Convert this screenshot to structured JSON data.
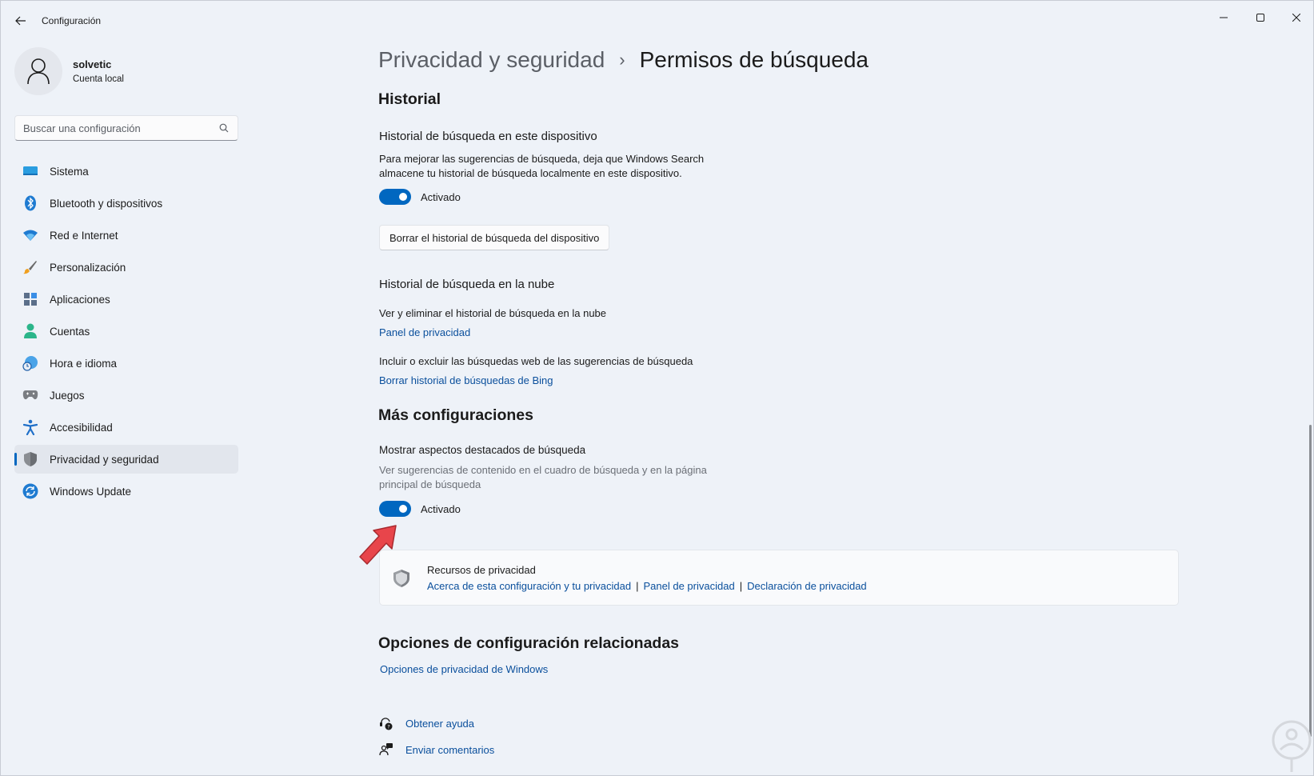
{
  "window": {
    "title": "Configuración"
  },
  "profile": {
    "name": "solvetic",
    "account_type": "Cuenta local"
  },
  "search": {
    "placeholder": "Buscar una configuración"
  },
  "sidebar": {
    "items": [
      {
        "label": "Sistema",
        "icon": "system-icon"
      },
      {
        "label": "Bluetooth y dispositivos",
        "icon": "bluetooth-icon"
      },
      {
        "label": "Red e Internet",
        "icon": "wifi-icon"
      },
      {
        "label": "Personalización",
        "icon": "brush-icon"
      },
      {
        "label": "Aplicaciones",
        "icon": "apps-icon"
      },
      {
        "label": "Cuentas",
        "icon": "account-icon"
      },
      {
        "label": "Hora e idioma",
        "icon": "clock-globe-icon"
      },
      {
        "label": "Juegos",
        "icon": "gamepad-icon"
      },
      {
        "label": "Accesibilidad",
        "icon": "accessibility-icon"
      },
      {
        "label": "Privacidad y seguridad",
        "icon": "shield-icon",
        "active": true
      },
      {
        "label": "Windows Update",
        "icon": "update-icon"
      }
    ]
  },
  "breadcrumb": {
    "parent": "Privacidad y seguridad",
    "separator": "›",
    "current": "Permisos de búsqueda"
  },
  "historial": {
    "heading": "Historial",
    "device": {
      "title": "Historial de búsqueda en este dispositivo",
      "description": "Para mejorar las sugerencias de búsqueda, deja que Windows Search almacene tu historial de búsqueda localmente en este dispositivo.",
      "toggle_label": "Activado",
      "toggle_on": true,
      "clear_button": "Borrar el historial de búsqueda del dispositivo"
    },
    "cloud": {
      "title": "Historial de búsqueda en la nube",
      "desc1": "Ver y eliminar el historial de búsqueda en la nube",
      "link1": "Panel de privacidad",
      "desc2": "Incluir o excluir las búsquedas web de las sugerencias de búsqueda",
      "link2": "Borrar historial de búsquedas de Bing"
    }
  },
  "more": {
    "heading": "Más configuraciones",
    "highlights": {
      "title": "Mostrar aspectos destacados de búsqueda",
      "description": "Ver sugerencias de contenido en el cuadro de búsqueda y en la página principal de búsqueda",
      "toggle_label": "Activado",
      "toggle_on": true
    }
  },
  "resources": {
    "title": "Recursos de privacidad",
    "links": [
      "Acerca de esta configuración y tu privacidad",
      "Panel de privacidad",
      "Declaración de privacidad"
    ],
    "separator": "|"
  },
  "related": {
    "heading": "Opciones de configuración relacionadas",
    "link": "Opciones de privacidad de Windows"
  },
  "help": {
    "get_help": "Obtener ayuda",
    "feedback": "Enviar comentarios"
  },
  "colors": {
    "accent": "#0067c0",
    "link": "#0a4f9c",
    "background": "#eef2f8",
    "annotation_arrow": "#e8454b"
  }
}
